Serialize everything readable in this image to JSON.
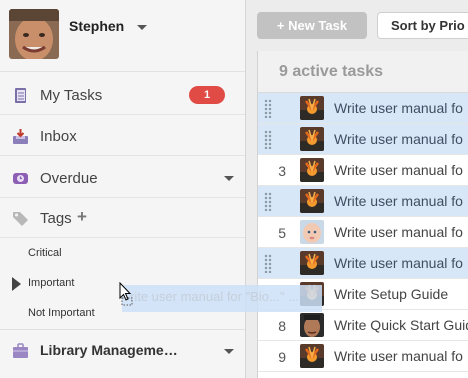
{
  "user": {
    "name": "Stephen"
  },
  "sidebar": {
    "nav": [
      {
        "label": "My Tasks",
        "badge": "1",
        "icon": "notebook-icon"
      },
      {
        "label": "Inbox",
        "icon": "inbox-tray-icon"
      },
      {
        "label": "Overdue",
        "icon": "alarm-icon"
      },
      {
        "label": "Tags",
        "icon": "tag-icon",
        "action": "+"
      }
    ],
    "tags": [
      "Critical",
      "Important",
      "Not Important"
    ],
    "library": {
      "label": "Library Manageme…",
      "icon": "briefcase-icon"
    }
  },
  "toolbar": {
    "new_task": "+ New Task",
    "sort": "Sort by Prio"
  },
  "list": {
    "header": "9 active tasks",
    "rows": [
      {
        "num": "",
        "title": "Write user manual fo",
        "avatar": "sunset-avatar",
        "selected": true,
        "handle": true
      },
      {
        "num": "",
        "title": "Write user manual fo",
        "avatar": "sunset-avatar",
        "selected": true,
        "handle": true
      },
      {
        "num": "3",
        "title": "Write user manual fo",
        "avatar": "sunset-avatar",
        "selected": false,
        "handle": false
      },
      {
        "num": "",
        "title": "Write user manual fo",
        "avatar": "sunset-avatar",
        "selected": true,
        "handle": true
      },
      {
        "num": "5",
        "title": "Write user manual fo",
        "avatar": "baby-avatar",
        "selected": false,
        "handle": false
      },
      {
        "num": "",
        "title": "Write user manual fo",
        "avatar": "sunset-avatar",
        "selected": true,
        "handle": true
      },
      {
        "num": "",
        "title": "Write Setup Guide",
        "avatar": "sunset-avatar",
        "selected": false,
        "handle": false
      },
      {
        "num": "8",
        "title": "Write Quick Start Guid",
        "avatar": "man-avatar",
        "selected": false,
        "handle": false
      },
      {
        "num": "9",
        "title": "Write user manual fo",
        "avatar": "sunset-avatar",
        "selected": false,
        "handle": false
      }
    ]
  },
  "drag_ghost": {
    "text": "rite user manual for \"Bio...\" ..."
  },
  "colors": {
    "badge": "#e04b45",
    "selected_row": "#d8e7f7",
    "sidebar_bg": "#f5f5f5"
  }
}
